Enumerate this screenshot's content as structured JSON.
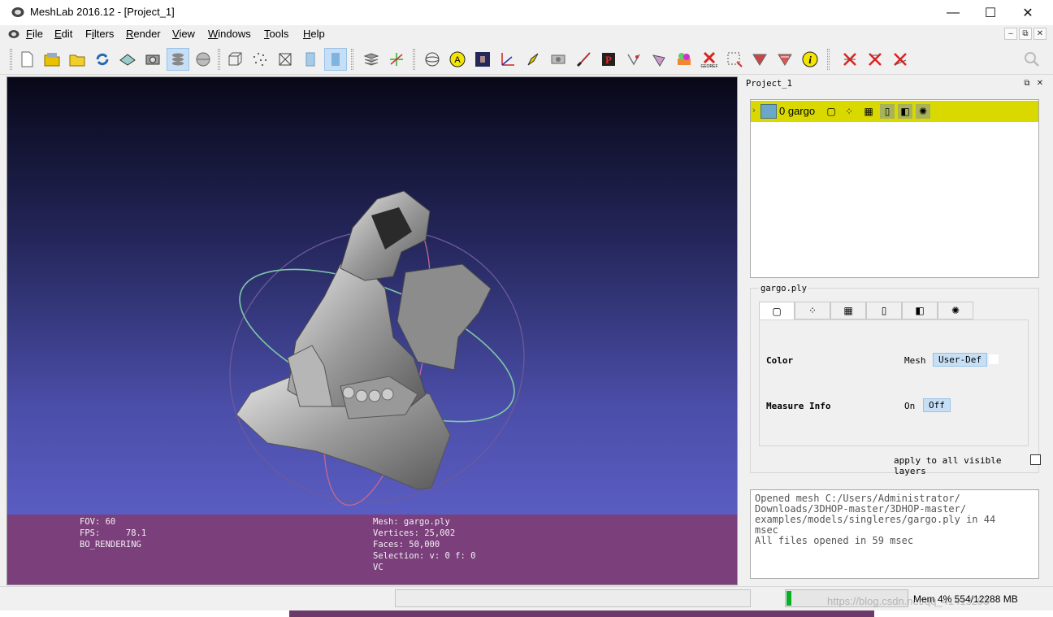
{
  "window": {
    "title": "MeshLab 2016.12 - [Project_1]",
    "minimize_glyph": "—",
    "maximize_glyph": "☐",
    "close_glyph": "✕"
  },
  "menu": {
    "items": [
      {
        "prefix": "",
        "u": "F",
        "rest": "ile"
      },
      {
        "prefix": "",
        "u": "E",
        "rest": "dit"
      },
      {
        "prefix": "F",
        "u": "i",
        "rest": "lters"
      },
      {
        "prefix": "",
        "u": "R",
        "rest": "ender"
      },
      {
        "prefix": "",
        "u": "V",
        "rest": "iew"
      },
      {
        "prefix": "",
        "u": "W",
        "rest": "indows"
      },
      {
        "prefix": "",
        "u": "T",
        "rest": "ools"
      },
      {
        "prefix": "",
        "u": "H",
        "rest": "elp"
      }
    ],
    "mdi_min": "–",
    "mdi_restore": "⧉",
    "mdi_close": "✕"
  },
  "toolbar": {
    "icons": [
      "new-project",
      "open-project",
      "open-mesh",
      "reload",
      "save-mesh",
      "snapshot",
      "layers",
      "sphere-view",
      "bbox",
      "points",
      "wireframe",
      "flat",
      "smooth",
      "layer-stack",
      "axes",
      "trackball",
      "annotation",
      "raster",
      "measure",
      "paint-tool",
      "snapshot-camera",
      "brush",
      "pick-points",
      "align",
      "manual-edit",
      "reference",
      "georef",
      "select-faces",
      "select-vertices",
      "select-conn",
      "info",
      "delete-faces",
      "delete-verts",
      "delete-both",
      "search"
    ]
  },
  "viewport": {
    "info_left": [
      "FOV: 60",
      "FPS:     78.1",
      "BO_RENDERING"
    ],
    "info_right": [
      "Mesh: gargo.ply",
      "Vertices: 25,002",
      "Faces: 50,000",
      "Selection: v: 0 f: 0",
      "VC"
    ],
    "gradient_top": "#080818",
    "gradient_bottom": "#6466d2",
    "info_bg": "#7b3f7c"
  },
  "dock": {
    "title": "Project_1",
    "layer": {
      "name": "0 gargo",
      "highlight": "#d9d900"
    },
    "props_title": "gargo.ply",
    "color_label": "Color",
    "color_opt_mesh": "Mesh",
    "color_opt_user": "User-Def",
    "measure_label": "Measure Info",
    "measure_on": "On",
    "measure_off": "Off",
    "apply_label": "apply to all visible layers",
    "log": [
      "Opened mesh C:/Users/Administrator/",
      "Downloads/3DHOP-master/3DHOP-master/",
      "examples/models/singleres/gargo.ply in 44",
      "msec",
      "All files opened in 59 msec"
    ]
  },
  "status": {
    "mem_label": "Mem 4% 554/12288 MB",
    "mem_fraction": 0.04,
    "watermark": "https://blog.csdn.net/qq_41413293"
  }
}
